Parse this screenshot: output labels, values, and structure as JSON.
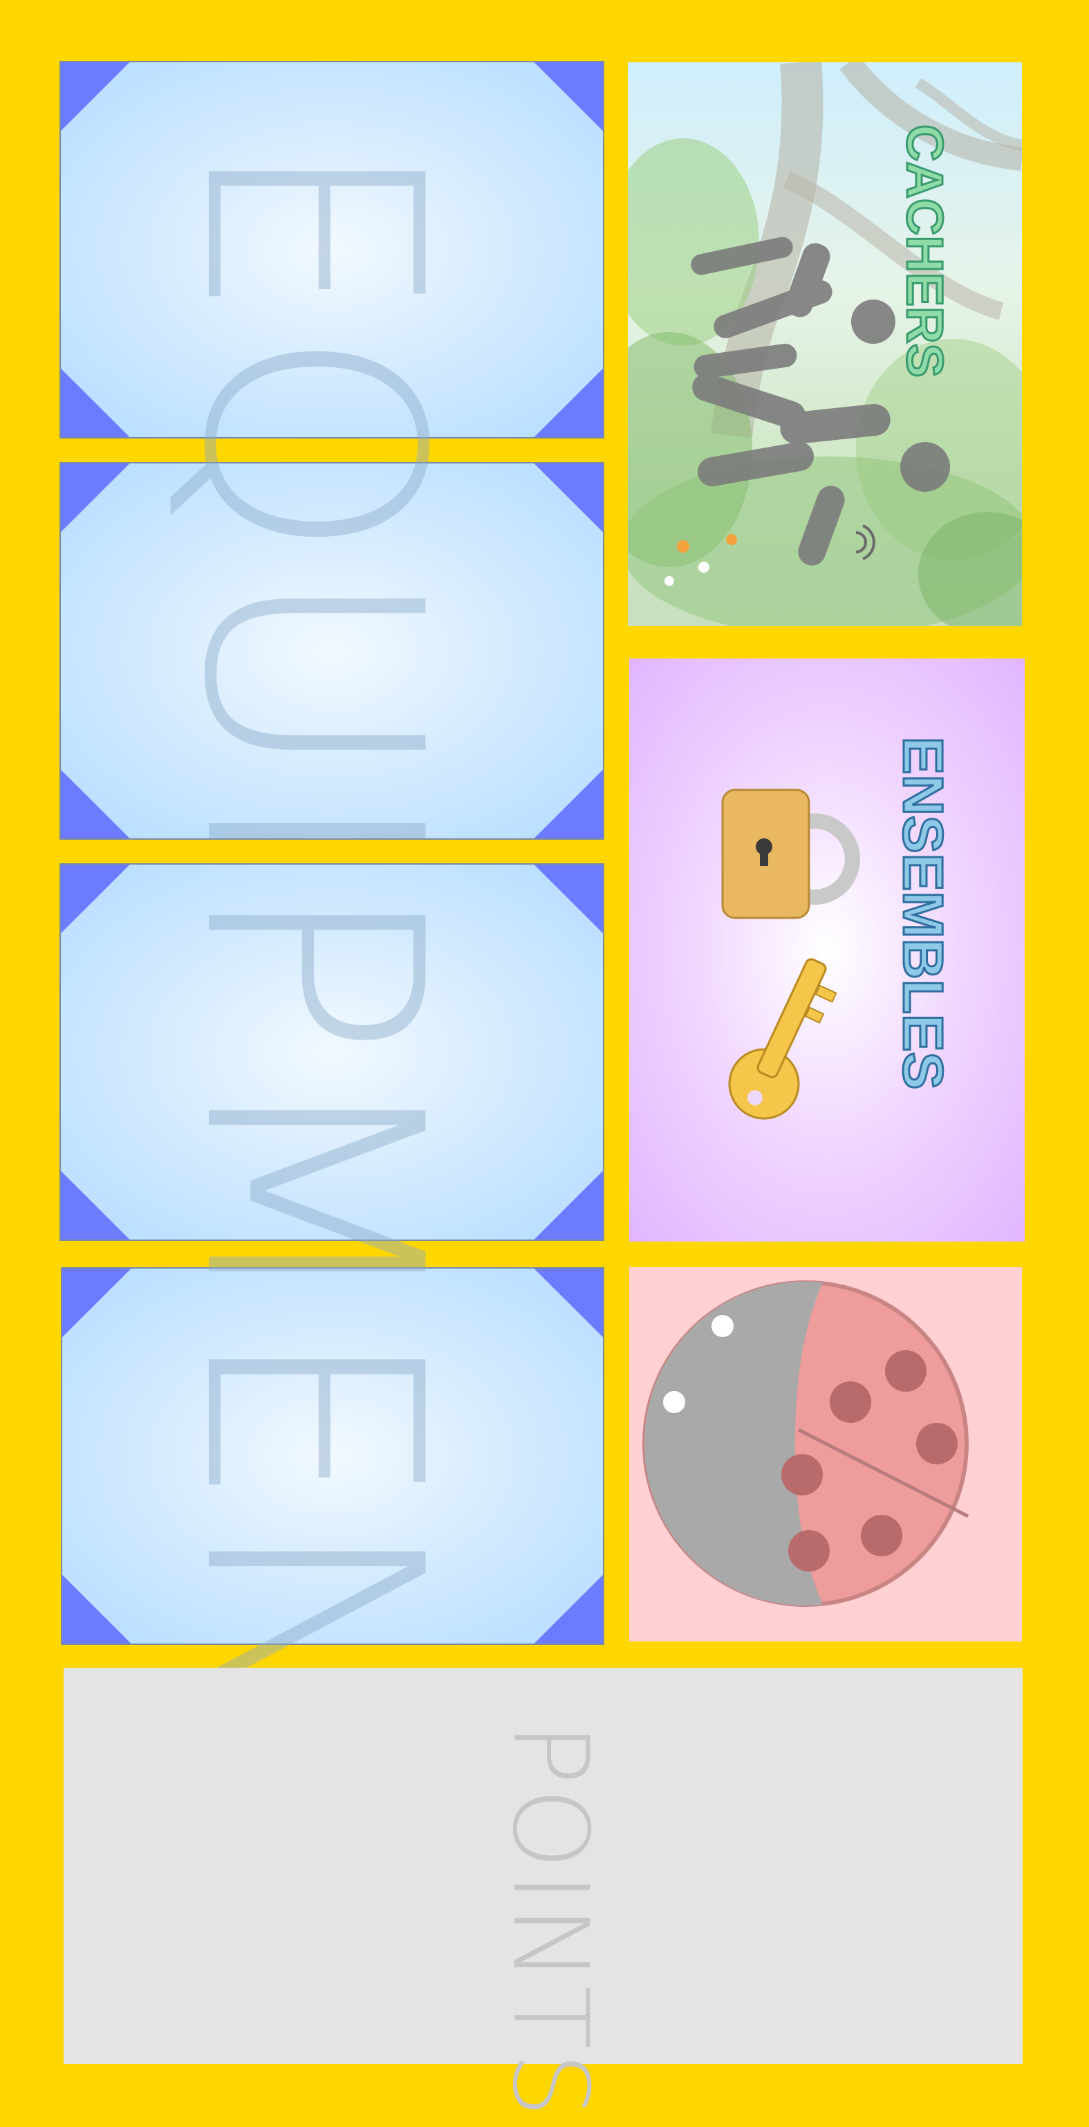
{
  "equipment": {
    "word": "EQUIPMENT"
  },
  "cachers": {
    "label": "CACHERS"
  },
  "ensembles": {
    "label": "ENSEMBLES"
  },
  "points": {
    "label": "POINTS"
  },
  "ladybug": {
    "icon": "ladybug-icon"
  },
  "colors": {
    "background": "#FFD700",
    "tile": "#b3dcff",
    "corner": "#6d7cff",
    "ensembles": "#e1b5ff",
    "ladybug_panel": "#ffd1d3",
    "points_panel": "#e4e4e4"
  }
}
